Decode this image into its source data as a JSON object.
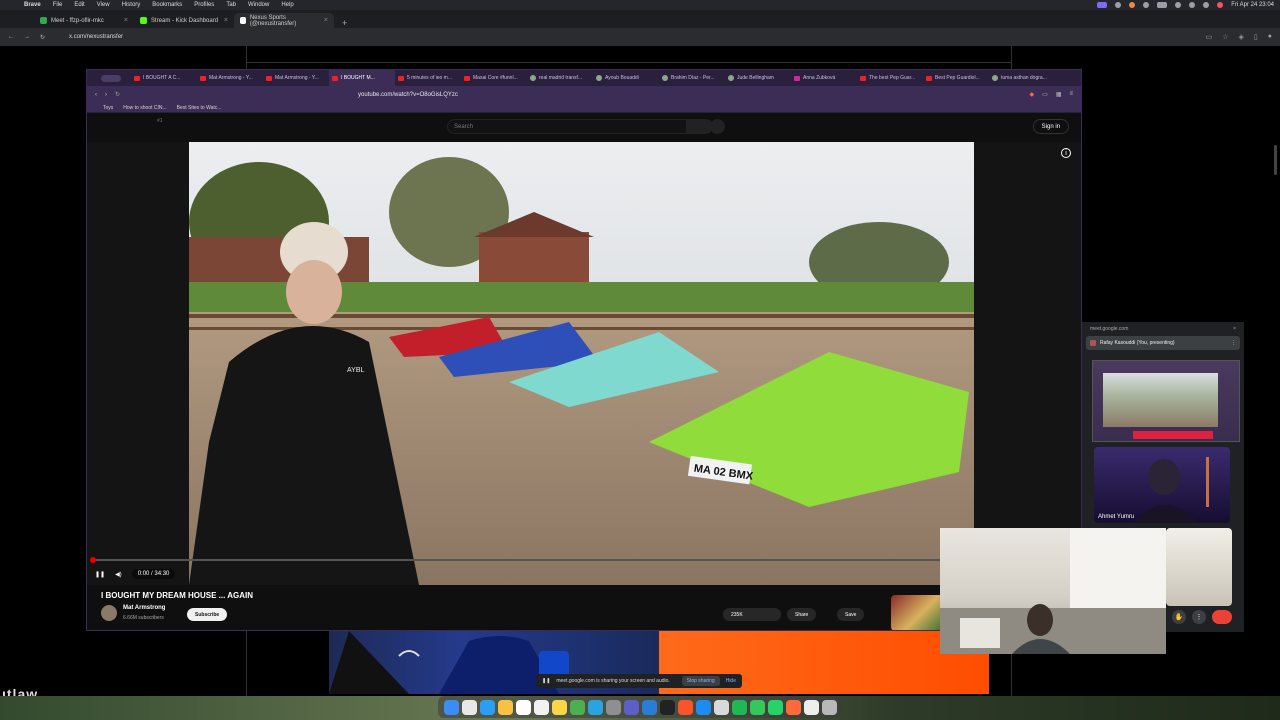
{
  "menubar": {
    "app": "Brave",
    "items": [
      "File",
      "Edit",
      "View",
      "History",
      "Bookmarks",
      "Profiles",
      "Tab",
      "Window",
      "Help"
    ],
    "clock": "Fri Apr 24  23:04"
  },
  "outer_browser": {
    "tabs": [
      {
        "label": "Meet - ffzp-oflir-mkc",
        "favicon_color": "#34a853"
      },
      {
        "label": "Stream - Kick Dashboard",
        "favicon_color": "#53fc18"
      },
      {
        "label": "Nexus Sports (@nexustransfer)",
        "favicon_color": "#ffffff"
      }
    ],
    "new_tab": "+",
    "url": "x.com/nexustransfer"
  },
  "inner_browser": {
    "tabs": [
      {
        "label": "I BOUGHT A C...",
        "icon": "yt"
      },
      {
        "label": "Mat Armstrong - Y...",
        "icon": "yt"
      },
      {
        "label": "Mat Armstrong - Y...",
        "icon": "yt"
      },
      {
        "label": "I BOUGHT M...",
        "icon": "yt"
      },
      {
        "label": "5 minutes of ieo m...",
        "icon": "yt"
      },
      {
        "label": "Masai Core #funnl...",
        "icon": "yt"
      },
      {
        "label": "real madrid transf...",
        "icon": "g"
      },
      {
        "label": "Ayoub Bouaddi",
        "icon": "g"
      },
      {
        "label": "Brahim Díaz - Per...",
        "icon": "g"
      },
      {
        "label": "Jude Bellingham",
        "icon": "g"
      },
      {
        "label": "Anna Zubková",
        "icon": "ig"
      },
      {
        "label": "The best Pep Guar...",
        "icon": "yt"
      },
      {
        "label": "Best Pep Guardiol...",
        "icon": "yt"
      },
      {
        "label": "tuma asthan dogra...",
        "icon": "g"
      }
    ],
    "url": "youtube.com/watch?v=O8oGisLQYzc",
    "bookmarks": [
      "Toys",
      "How to shoot CIN...",
      "Best Sites to Watc..."
    ]
  },
  "youtube": {
    "search_placeholder": "Search",
    "sign_in": "Sign in",
    "time": "0:00 / 34:30",
    "progress_fraction": 0.0,
    "video_title": "I BOUGHT MY DREAM HOUSE ... AGAIN",
    "channel_name": "Mat Armstrong",
    "channel_subs": "6.66M subscribers",
    "subscribe": "Subscribe",
    "likes": "235K",
    "share": "Share",
    "save": "Save",
    "plate": "MA 02 BMX",
    "hoodie_text": "AYBL",
    "menu_marker": "#1"
  },
  "meet": {
    "url": "meet.google.com",
    "presenting_label": "Rafay Kasouddi (You, presenting)",
    "participant_name": "Ahmet Yumru",
    "sharing_text": "meet.google.com is sharing your screen and audio.",
    "stop_sharing": "Stop sharing",
    "hide": "Hide"
  },
  "page": {
    "corner_text": "ıtlaw"
  },
  "colors": {
    "inner_chrome": "#3b2d56",
    "yt_red": "#ff0000",
    "meet_end": "#ea4335"
  }
}
